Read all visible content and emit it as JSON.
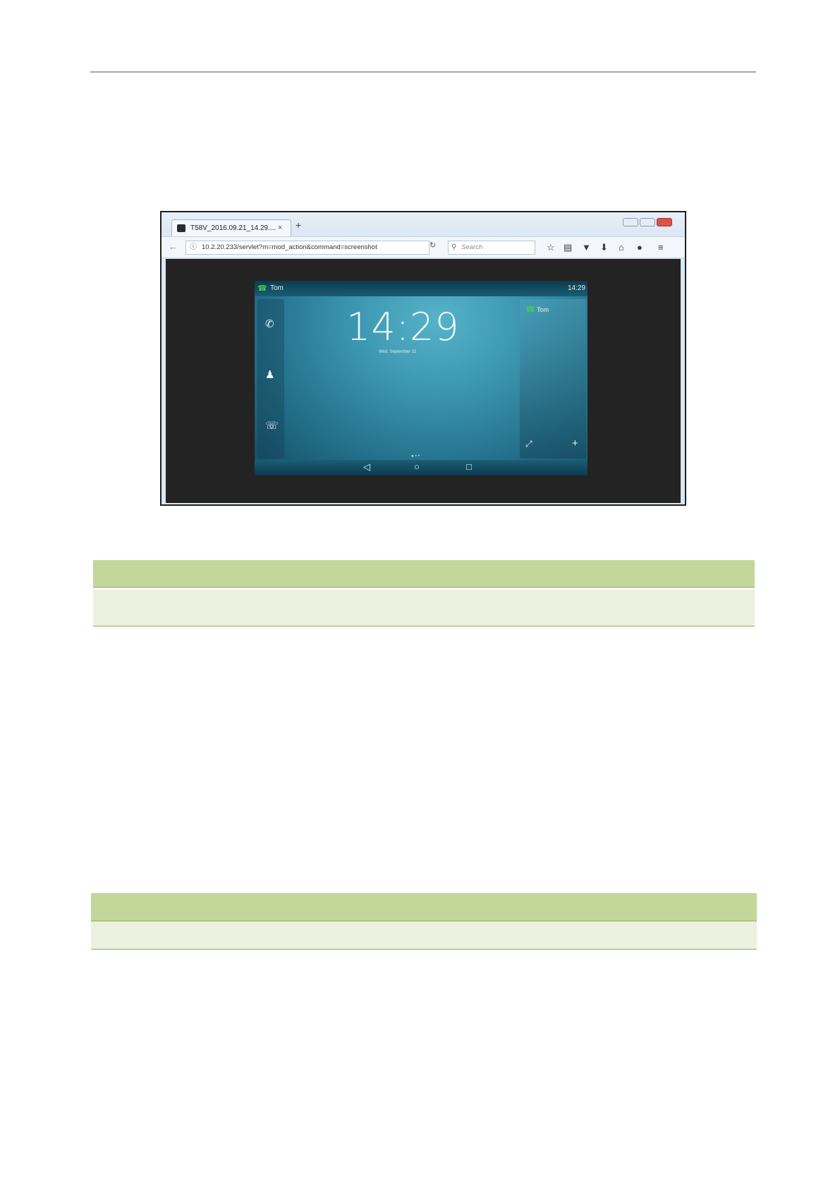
{
  "browser": {
    "tab_title": "T58V_2016.09.21_14.29....",
    "tab_close": "×",
    "new_tab": "+",
    "url": "10.2.20.233/servlet?m=mod_action&command=screenshot",
    "search_placeholder": "Search",
    "icons": [
      "back-arrow-icon",
      "info-icon",
      "reload-icon",
      "search-icon",
      "bookmark-star-icon",
      "clipboard-icon",
      "pocket-icon",
      "download-icon",
      "home-icon",
      "chat-icon",
      "menu-icon"
    ]
  },
  "phone": {
    "status_name": "Tom",
    "status_time": "14:29",
    "clock": "14:29",
    "date": "Wed, September 21",
    "account_name": "Tom"
  }
}
